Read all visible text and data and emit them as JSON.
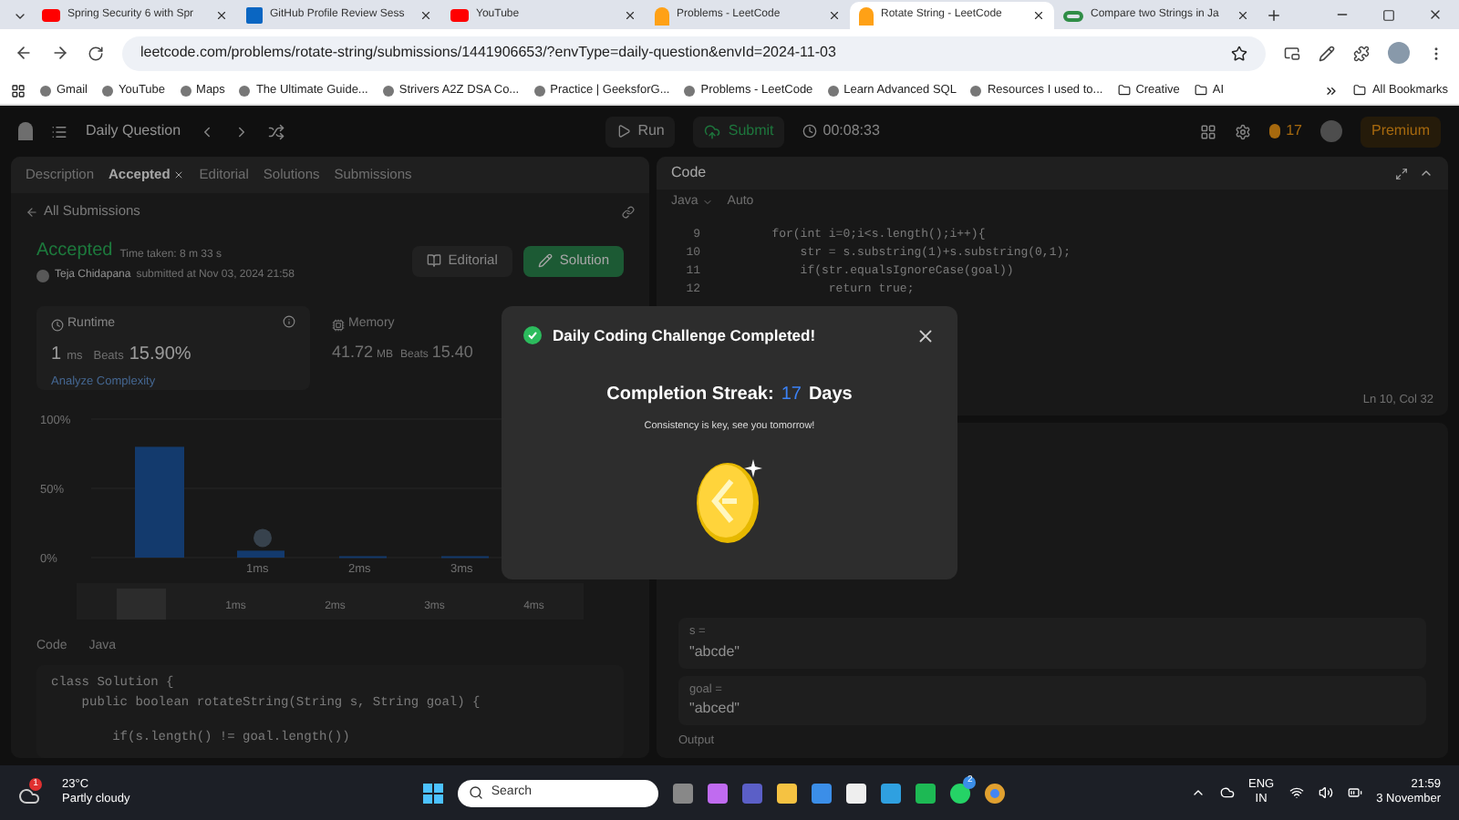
{
  "browser": {
    "tabs": [
      {
        "title": "Spring Security 6 with Spr",
        "selected": false
      },
      {
        "title": "GitHub Profile Review Sess",
        "selected": false
      },
      {
        "title": "YouTube",
        "selected": false
      },
      {
        "title": "Problems - LeetCode",
        "selected": false
      },
      {
        "title": "Rotate String - LeetCode",
        "selected": true
      },
      {
        "title": "Compare two Strings in Ja",
        "selected": false
      }
    ],
    "url": "leetcode.com/problems/rotate-string/submissions/1441906653/?envType=daily-question&envId=2024-11-03",
    "bookmarks": [
      "Gmail",
      "YouTube",
      "Maps",
      "The Ultimate Guide...",
      "Strivers A2Z DSA Co...",
      "Practice | GeeksforG...",
      "Problems - LeetCode",
      "Learn Advanced SQL",
      "Resources I used to...",
      "Creative",
      "AI"
    ],
    "all_bookmarks": "All Bookmarks"
  },
  "topbar": {
    "title": "Daily Question",
    "run": "Run",
    "submit": "Submit",
    "timer": "00:08:33",
    "streak": "17",
    "premium": "Premium"
  },
  "left": {
    "tabs": [
      {
        "label": "Description",
        "selected": false
      },
      {
        "label": "Accepted",
        "selected": true
      },
      {
        "label": "Editorial",
        "selected": false
      },
      {
        "label": "Solutions",
        "selected": false
      },
      {
        "label": "Submissions",
        "selected": false
      }
    ],
    "back": "All Submissions",
    "status": "Accepted",
    "time_taken": "Time taken: 8 m 33 s",
    "user": "Teja Chidapana",
    "submitted": "submitted at Nov 03, 2024 21:58",
    "editorial_button": "Editorial",
    "solution_button": "Solution",
    "runtime": {
      "label": "Runtime",
      "value": "1",
      "unit": "ms",
      "beats": "Beats",
      "percent": "15.90%",
      "link": "Analyze Complexity"
    },
    "memory": {
      "label": "Memory",
      "value": "41.72",
      "unit": "MB",
      "beats": "Beats",
      "percent": "15.40"
    },
    "chart_data": {
      "type": "bar",
      "categories": [
        null,
        "1ms",
        "2ms",
        "3ms"
      ],
      "values": [
        80,
        5,
        1,
        1
      ],
      "yticks": [
        {
          "value": 0,
          "label": "0%"
        },
        {
          "value": 50,
          "label": "50%"
        },
        {
          "value": 100,
          "label": "100%"
        }
      ],
      "ylim": [
        0,
        100
      ]
    },
    "range_labels": [
      "1ms",
      "2ms",
      "3ms",
      "4ms"
    ],
    "code_label": "Code",
    "code_lang": "Java",
    "code": [
      "class Solution {",
      "    public boolean rotateString(String s, String goal) {",
      "        if(s.length() != goal.length())"
    ]
  },
  "editor": {
    "title": "Code",
    "lang": "Java",
    "mode": "Auto",
    "lines": [
      {
        "n": "9",
        "text": "        for(int i=0;i<s.length();i++){"
      },
      {
        "n": "10",
        "text": "            str = s.substring(1)+s.substring(0,1);"
      },
      {
        "n": "11",
        "text": "            if(str.equalsIgnoreCase(goal))"
      },
      {
        "n": "12",
        "text": "                return true;"
      }
    ],
    "position": "Ln 10, Col 32"
  },
  "testcase": {
    "cases": [
      {
        "name": "s =",
        "value": "\"abcde\""
      },
      {
        "name": "goal =",
        "value": "\"abced\""
      }
    ],
    "output": "Output"
  },
  "modal": {
    "title": "Daily Coding Challenge Completed!",
    "streak_label": "Completion Streak:",
    "streak": "17",
    "days": "Days",
    "message": "Consistency is key, see you tomorrow!"
  },
  "taskbar": {
    "temp": "23°C",
    "weather": "Partly cloudy",
    "weather_badge": "1",
    "search": "Search",
    "whatsapp_badge": "2",
    "lang": "ENG",
    "region": "IN",
    "time": "21:59",
    "date": "3 November"
  }
}
